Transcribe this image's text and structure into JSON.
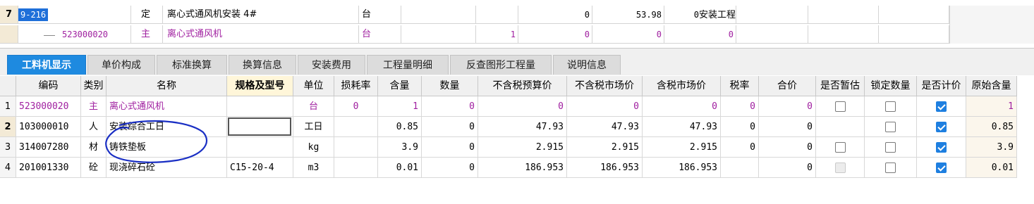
{
  "top_rows": {
    "row7": {
      "num": "7",
      "code": "9-216",
      "type": "定",
      "name": "离心式通风机安装 4#",
      "unit": "台",
      "v1": "0",
      "v2": "53.98",
      "v3": "0",
      "category": "安装工程"
    },
    "sub": {
      "code": "523000020",
      "type": "主",
      "name": "离心式通风机",
      "unit": "台",
      "v0": "1",
      "v1": "0",
      "v2": "0",
      "v3": "0"
    }
  },
  "tabs": [
    {
      "label": "工料机显示",
      "active": true
    },
    {
      "label": "单价构成"
    },
    {
      "label": "标准换算"
    },
    {
      "label": "换算信息"
    },
    {
      "label": "安装费用"
    },
    {
      "label": "工程量明细"
    },
    {
      "label": "反查图形工程量"
    },
    {
      "label": "说明信息"
    }
  ],
  "columns": [
    "编码",
    "类别",
    "名称",
    "规格及型号",
    "单位",
    "损耗率",
    "含量",
    "数量",
    "不含税预算价",
    "不含税市场价",
    "含税市场价",
    "税率",
    "合价",
    "是否暂估",
    "锁定数量",
    "是否计价",
    "原始含量"
  ],
  "rows": [
    {
      "n": "1",
      "code": "523000020",
      "type": "主",
      "name": "离心式通风机",
      "spec": "",
      "unit": "台",
      "loss": "0",
      "qty_ratio": "1",
      "qty": "0",
      "pre_tax_budget": "0",
      "pre_tax_market": "0",
      "tax_market": "0",
      "tax_rate": "0",
      "total": "0",
      "provisional": "unchecked",
      "locked": "unchecked",
      "priced": "checked",
      "orig": "1",
      "style": "purple"
    },
    {
      "n": "2",
      "code": "103000010",
      "type": "人",
      "name": "安装综合工日",
      "spec": "",
      "unit": "工日",
      "loss": "",
      "qty_ratio": "0.85",
      "qty": "0",
      "pre_tax_budget": "47.93",
      "pre_tax_market": "47.93",
      "tax_market": "47.93",
      "tax_rate": "0",
      "total": "0",
      "provisional": "none",
      "locked": "unchecked",
      "priced": "checked",
      "orig": "0.85",
      "style": "normal"
    },
    {
      "n": "3",
      "code": "314007280",
      "type": "材",
      "name": "铸铁垫板",
      "spec": "",
      "unit": "kg",
      "loss": "",
      "qty_ratio": "3.9",
      "qty": "0",
      "pre_tax_budget": "2.915",
      "pre_tax_market": "2.915",
      "tax_market": "2.915",
      "tax_rate": "0",
      "total": "0",
      "provisional": "unchecked",
      "locked": "unchecked",
      "priced": "checked",
      "orig": "3.9",
      "style": "normal"
    },
    {
      "n": "4",
      "code": "201001330",
      "type": "砼",
      "name": "现浇碎石砼",
      "spec": "C15-20-4",
      "unit": "m3",
      "loss": "",
      "qty_ratio": "0.01",
      "qty": "0",
      "pre_tax_budget": "186.953",
      "pre_tax_market": "186.953",
      "tax_market": "186.953",
      "tax_rate": "",
      "total": "0",
      "provisional": "disabled",
      "locked": "unchecked",
      "priced": "checked",
      "orig": "0.01",
      "style": "normal"
    }
  ],
  "colors": {
    "accent": "#1e8ae0",
    "purple": "#a020a0",
    "annotation": "#1a2fc4"
  }
}
